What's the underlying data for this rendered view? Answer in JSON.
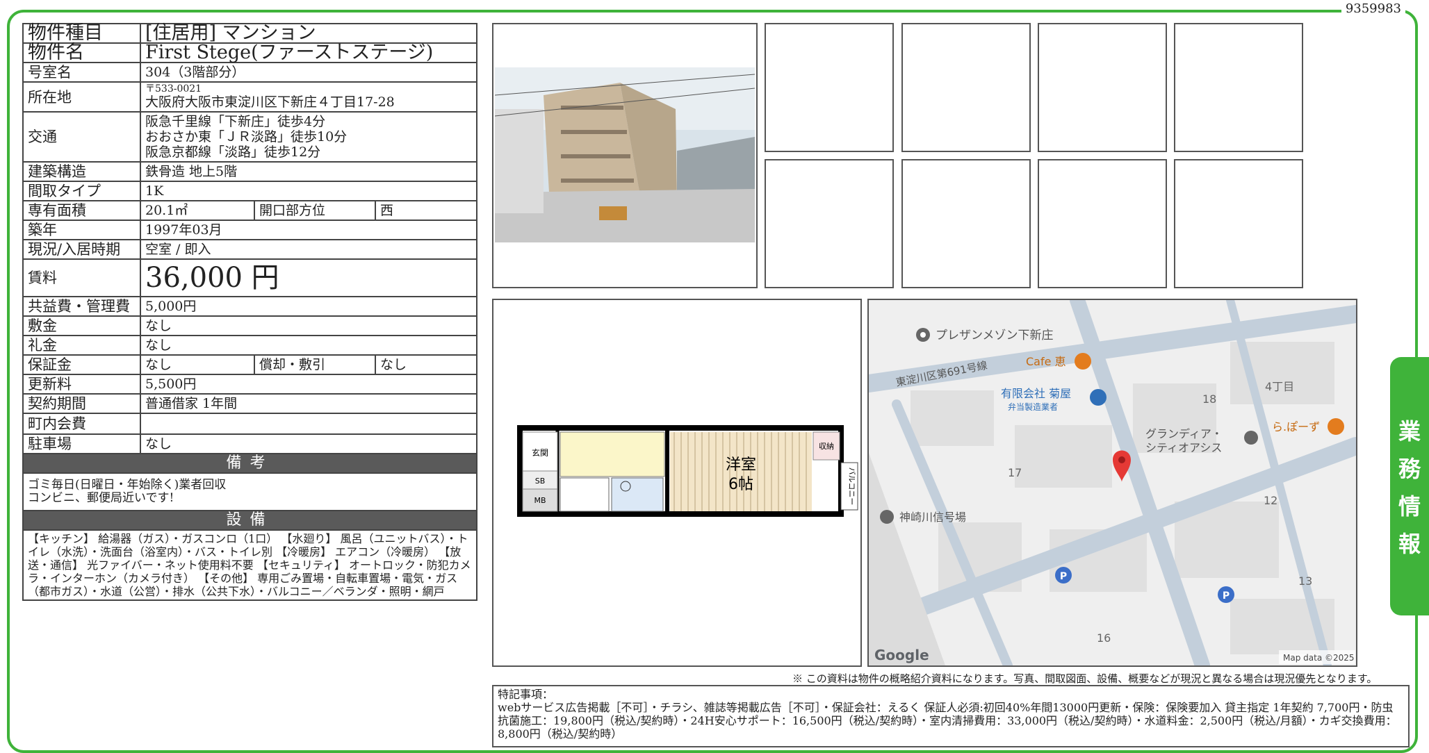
{
  "document_id": "9359983",
  "side_tab": [
    "業",
    "務",
    "情",
    "報"
  ],
  "spec": {
    "type_label": "物件種目",
    "type_value": "[住居用] マンション",
    "name_label": "物件名",
    "name_value": "First Stege(ファーストステージ)",
    "room_label": "号室名",
    "room_value": "304（3階部分）",
    "address_label": "所在地",
    "address_zip": "〒533-0021",
    "address_value": "大阪府大阪市東淀川区下新庄４丁目17-28",
    "transit_label": "交通",
    "transit": [
      "阪急千里線「下新庄」徒歩4分",
      "おおさか東「ＪＲ淡路」徒歩10分",
      "阪急京都線「淡路」徒歩12分"
    ],
    "structure_label": "建築構造",
    "structure_value": "鉄骨造 地上5階",
    "layout_label": "間取タイプ",
    "layout_value": "1K",
    "area_label": "専有面積",
    "area_value": "20.1㎡",
    "direction_label": "開口部方位",
    "direction_value": "西",
    "built_label": "築年",
    "built_value": "1997年03月",
    "status_label": "現況/入居時期",
    "status_value": "空室 / 即入",
    "rent_label": "賃料",
    "rent_value": "36,000 円",
    "fee_label": "共益費・管理費",
    "fee_value": "5,000円",
    "deposit_label": "敷金",
    "deposit_value": "なし",
    "keymoney_label": "礼金",
    "keymoney_value": "なし",
    "guarantee_label": "保証金",
    "guarantee_value": "なし",
    "amort_label": "償却・敷引",
    "amort_value": "なし",
    "renewal_label": "更新料",
    "renewal_value": "5,500円",
    "contract_label": "契約期間",
    "contract_value": "普通借家 1年間",
    "town_label": "町内会費",
    "town_value": "",
    "parking_label": "駐車場",
    "parking_value": "なし",
    "remarks_header": "備考",
    "remarks": [
      "ゴミ毎日(日曜日・年始除く)業者回収",
      "コンビニ、郵便局近いです!"
    ],
    "equipment_header": "設備",
    "equipment": "【キッチン】 給湯器（ガス）・ガスコンロ（1口） 【水廻り】 風呂（ユニットバス）・トイレ（水洗）・洗面台（浴室内）・バス・トイレ別 【冷暖房】 エアコン（冷暖房） 【放送・通信】 光ファイバー・ネット使用料不要 【セキュリティ】 オートロック・防犯カメラ・インターホン（カメラ付き） 【その他】 専用ごみ置場・自転車置場・電気・ガス（都市ガス）・水道（公営）・排水（公共下水）・バルコニー／ベランダ・照明・網戸"
  },
  "floorplan": {
    "entrance": "玄関",
    "sb": "SB",
    "mb": "MB",
    "storage": "収納",
    "room": "洋室",
    "room_size": "6帖",
    "balcony": "バルコニー"
  },
  "map": {
    "labels": {
      "place1": "プレザンメゾン下新庄",
      "cafe": "Cafe 恵",
      "road": "東淀川区第691号線",
      "company": "有限会社 菊屋",
      "company_sub": "弁当製造業者",
      "apt": "グランディア・",
      "apt2": "シティオアシス",
      "ramen": "ら.ぽーず",
      "signal": "神崎川信号場",
      "block1": "18",
      "block2": "4丁目",
      "block3": "17",
      "block4": "12",
      "block5": "13",
      "block6": "16",
      "google": "Google",
      "attribution": "Map data ©2025"
    }
  },
  "disclaimer": "※ この資料は物件の概略紹介資料になります。写真、間取図面、設備、概要などが現況と異なる場合は現況優先となります。",
  "special_notes_title": "特記事項：",
  "special_notes": "webサービス広告掲載［不可］・チラシ、雑誌等掲載広告［不可］・保証会社：えるく 保証人必須:初回40%年間13000円更新・保険：保険要加入 貸主指定 1年契約 7,700円・防虫抗菌施工：19,800円（税込/契約時）・24H安心サポート：16,500円（税込/契約時）・室内清掃費用：33,000円（税込/契約時）・水道料金：2,500円（税込/月額）・カギ交換費用：8,800円（税込/契約時）",
  "colors": {
    "accent_green": "#3fb33a",
    "section_gray": "#5a5a5a"
  }
}
